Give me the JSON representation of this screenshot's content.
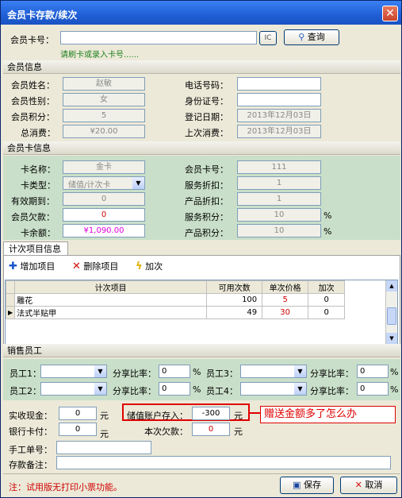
{
  "window": {
    "title": "会员卡存款/续次"
  },
  "search": {
    "card_label": "会员卡号：",
    "card_value": "",
    "ic_label": "IC",
    "query_label": "查询",
    "hint": "请刷卡或录入卡号......"
  },
  "member_info": {
    "header": "会员信息",
    "name_label": "会员姓名：",
    "name_value": "赵敏",
    "gender_label": "会员性别：",
    "gender_value": "女",
    "points_label": "会员积分：",
    "points_value": "5",
    "total_label": "总消费：",
    "total_value": "¥20.00",
    "phone_label": "电话号码：",
    "phone_value": "",
    "id_label": "身份证号：",
    "id_value": "",
    "reg_label": "登记日期：",
    "reg_value": "2013年12月03日",
    "last_label": "上次消费：",
    "last_value": "2013年12月03日"
  },
  "card_info": {
    "header": "会员卡信息",
    "card_name_label": "卡名称：",
    "card_name_value": "金卡",
    "card_type_label": "卡类型：",
    "card_type_value": "储值/计次卡",
    "valid_label": "有效期到：",
    "valid_value": "0",
    "debt_label": "会员欠款：",
    "debt_value": "0",
    "balance_label": "卡余额：",
    "balance_value": "¥1,090.00",
    "card_no_label": "会员卡号：",
    "card_no_value": "111",
    "service_disc_label": "服务折扣：",
    "service_disc_value": "1",
    "product_disc_label": "产品折扣：",
    "product_disc_value": "1",
    "service_pts_label": "服务积分：",
    "service_pts_value": "10",
    "product_pts_label": "产品积分：",
    "product_pts_value": "10",
    "pct": "%"
  },
  "count_items": {
    "header": "计次项目信息",
    "add_label": "增加项目",
    "delete_label": "删除项目",
    "addcount_label": "加次",
    "columns": [
      "计次项目",
      "可用次数",
      "单次价格",
      "加次"
    ],
    "rows": [
      {
        "item": "雕花",
        "avail": "100",
        "price": "5",
        "add": "0"
      },
      {
        "item": "法式半贴甲",
        "avail": "49",
        "price": "30",
        "add": "0"
      }
    ]
  },
  "sales": {
    "header": "销售员工",
    "emp1_label": "员工1：",
    "emp2_label": "员工2：",
    "emp3_label": "员工3：",
    "emp4_label": "员工4：",
    "share_label": "分享比率：",
    "share_value": "0",
    "pct": "%"
  },
  "payment": {
    "cash_label": "实收现金：",
    "cash_value": "0",
    "bank_label": "银行卡付：",
    "bank_value": "0",
    "yuan": "元",
    "deposit_label": "储值账户存入：",
    "deposit_value": "-300",
    "debt_label": "本次欠款：",
    "debt_value": "0",
    "annotation": "赠送金额多了怎么办",
    "manual_label": "手工单号：",
    "manual_value": "",
    "remark_label": "存款备注：",
    "remark_value": ""
  },
  "footer": {
    "note": "注：试用版无打印小票功能。",
    "save_label": "保存",
    "cancel_label": "取消"
  },
  "colors": {
    "accent_red": "#d00000",
    "balance_magenta": "#e000e0",
    "green_panel": "#c9dfc9"
  }
}
